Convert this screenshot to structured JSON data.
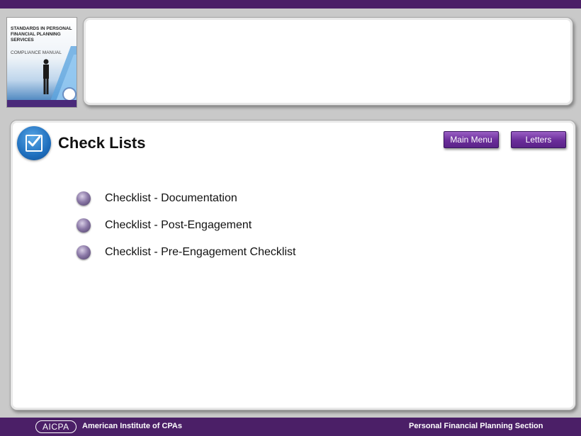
{
  "cover": {
    "title": "STANDARDS IN PERSONAL FINANCIAL PLANNING SERVICES",
    "subtitle": "COMPLIANCE MANUAL"
  },
  "page": {
    "title": "Check Lists"
  },
  "nav": {
    "main_menu": "Main Menu",
    "letters": "Letters"
  },
  "checklist": [
    {
      "label": "Checklist - Documentation"
    },
    {
      "label": "Checklist - Post-Engagement"
    },
    {
      "label": "Checklist - Pre-Engagement Checklist"
    }
  ],
  "footer": {
    "logo_text": "AICPA",
    "organization": "American Institute of CPAs",
    "section": "Personal Financial Planning Section"
  },
  "colors": {
    "brand_purple": "#4b1f67",
    "button_purple": "#6a2d99",
    "icon_blue": "#1f6fbe"
  }
}
